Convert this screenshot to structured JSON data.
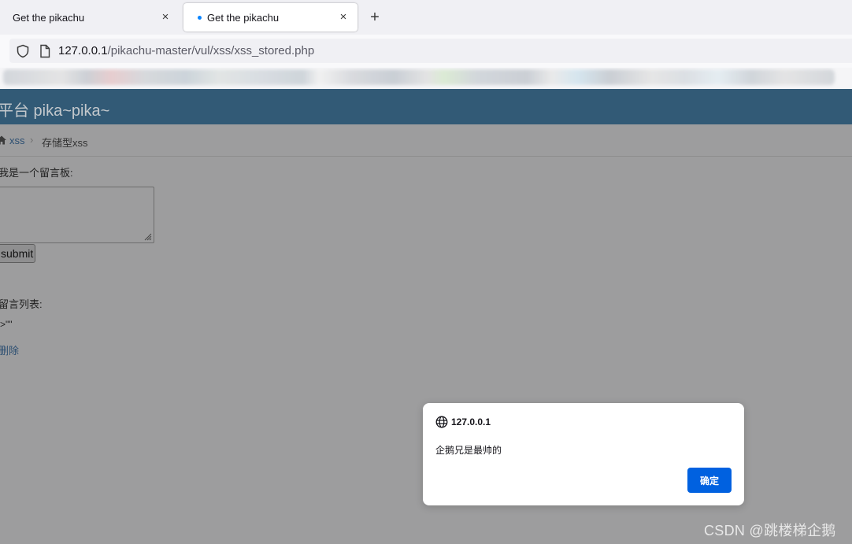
{
  "tabs": [
    {
      "title": "Get the pikachu",
      "close_glyph": "×",
      "active": false
    },
    {
      "title": "Get the pikachu",
      "close_glyph": "×",
      "active": true
    }
  ],
  "new_tab_glyph": "+",
  "address_bar": {
    "host": "127.0.0.1",
    "path": "/pikachu-master/vul/xss/xss_stored.php"
  },
  "page": {
    "brand": "平台 pika~pika~",
    "breadcrumb": {
      "link": "xss",
      "separator": "›",
      "current": "存储型xss"
    },
    "board_label": "我是一个留言板:",
    "submit_label": "submit",
    "list_label": "留言列表:",
    "list_item": ">\"\"",
    "delete_label": "删除"
  },
  "dialog": {
    "origin": "127.0.0.1",
    "message": "企鹅兄是最帅的",
    "ok_label": "确定"
  },
  "watermark": "CSDN @跳楼梯企鹅",
  "colors": {
    "header": "#325a76",
    "accent": "#0061e0",
    "overlay": "#9d9d9e"
  }
}
